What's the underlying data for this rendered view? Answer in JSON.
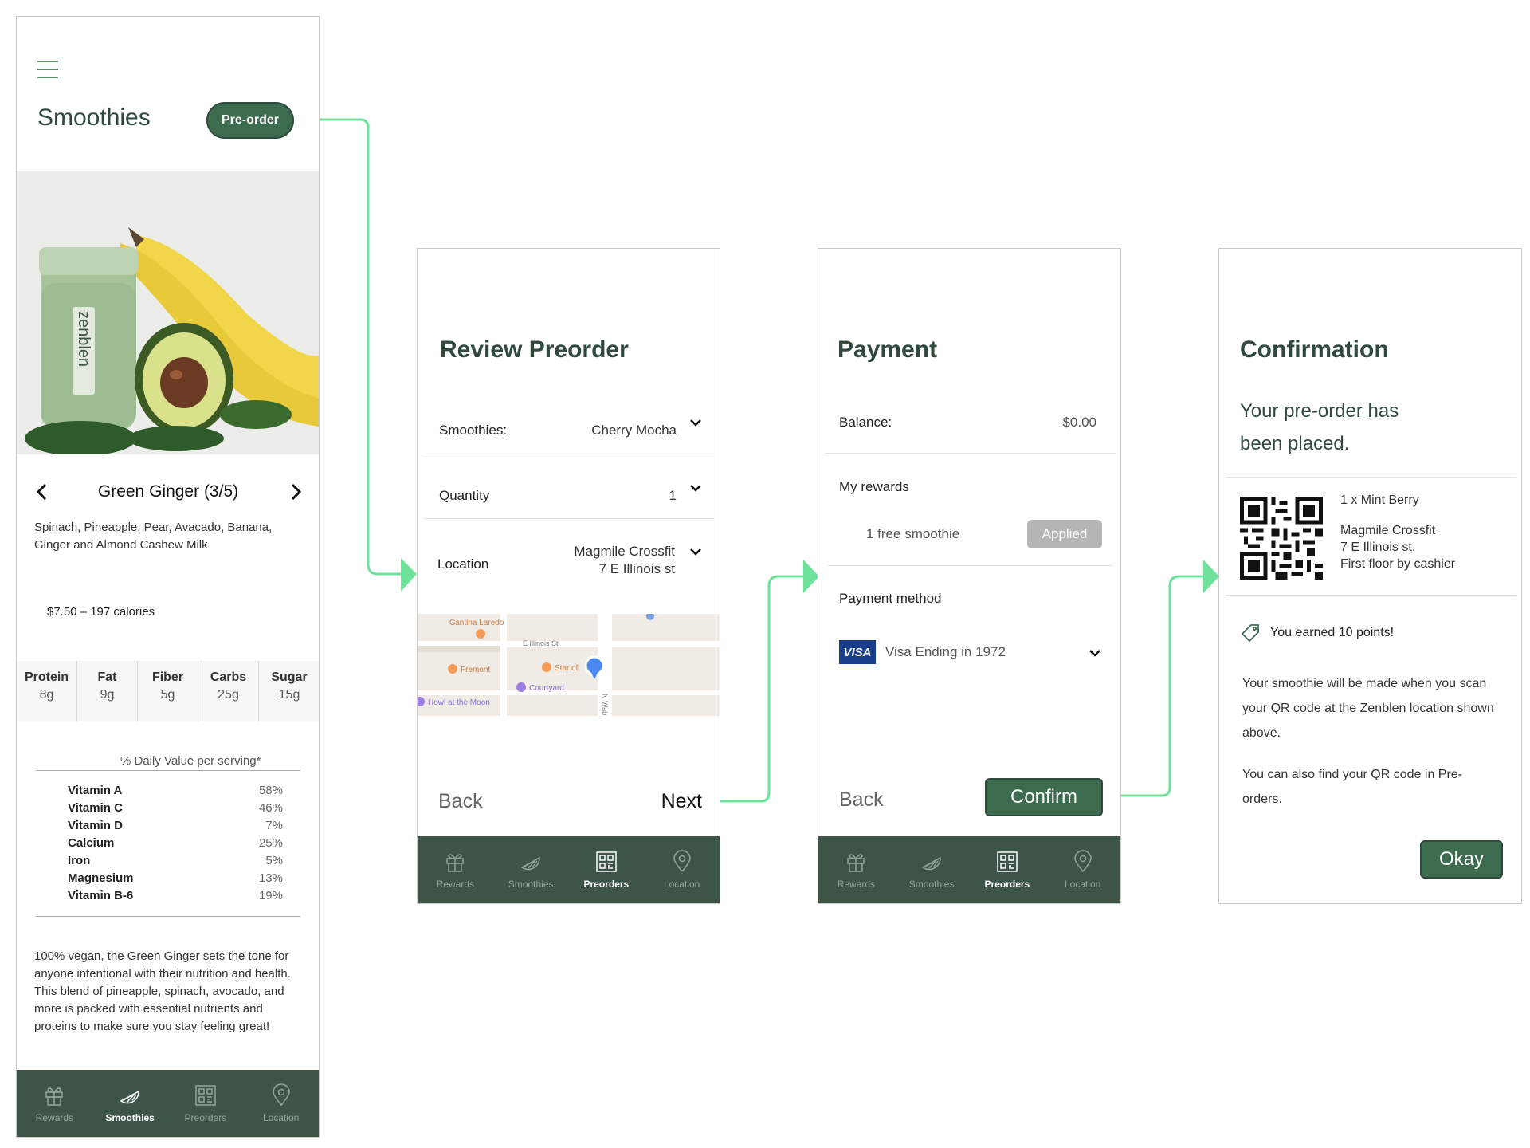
{
  "colors": {
    "brand_dark": "#2f4a3a",
    "brand_green": "#3d6b4f",
    "nav_bg": "#3d5546",
    "connector": "#6ee29a"
  },
  "nav": {
    "items": [
      {
        "key": "rewards",
        "label": "Rewards",
        "icon": "gift-icon"
      },
      {
        "key": "smoothies",
        "label": "Smoothies",
        "icon": "lime-icon"
      },
      {
        "key": "preorders",
        "label": "Preorders",
        "icon": "qr-code-icon"
      },
      {
        "key": "location",
        "label": "Location",
        "icon": "map-pin-icon"
      }
    ]
  },
  "screen1": {
    "title": "Smoothies",
    "preorder_button": "Pre-order",
    "product_name": "Green Ginger (3/5)",
    "ingredients": "Spinach, Pineapple, Pear, Avacado, Banana, Ginger and Almond Cashew Milk",
    "price_calories": "$7.50 – 197 calories",
    "image_brand_label": "zenblen",
    "nutrition": [
      {
        "name": "Protein",
        "value": "8g"
      },
      {
        "name": "Fat",
        "value": "9g"
      },
      {
        "name": "Fiber",
        "value": "5g"
      },
      {
        "name": "Carbs",
        "value": "25g"
      },
      {
        "name": "Sugar",
        "value": "15g"
      }
    ],
    "daily_value_header": "% Daily Value per serving*",
    "vitamins": [
      {
        "name": "Vitamin  A",
        "value": "58%"
      },
      {
        "name": "Vitamin C",
        "value": "46%"
      },
      {
        "name": "Vitamin D",
        "value": "7%"
      },
      {
        "name": "Calcium",
        "value": "25%"
      },
      {
        "name": "Iron",
        "value": "5%"
      },
      {
        "name": "Magnesium",
        "value": "13%"
      },
      {
        "name": "Vitamin B-6",
        "value": "19%"
      }
    ],
    "description": "100% vegan, the Green Ginger sets the tone for anyone intentional with their nutrition and health. This blend of pineapple, spinach, avocado, and more is packed with essential nutrients and proteins to make sure you stay feeling great!",
    "active_nav": "smoothies"
  },
  "screen2": {
    "title": "Review Preorder",
    "smoothies_label": "Smoothies:",
    "smoothies_value": "Cherry Mocha",
    "quantity_label": "Quantity",
    "quantity_value": "1",
    "location_label": "Location",
    "location_name": "Magmile Crossfit",
    "location_address": "7 E Illinois st",
    "map": {
      "places": [
        "Cantina Laredo",
        "Fremont",
        "Star of",
        "Courtyard",
        "Howl at the Moon"
      ],
      "streets": [
        "E Illinois St",
        "N Wab"
      ]
    },
    "back": "Back",
    "next": "Next",
    "active_nav": "preorders"
  },
  "screen3": {
    "title": "Payment",
    "balance_label": "Balance:",
    "balance_value": "$0.00",
    "rewards_label": "My rewards",
    "reward_item": "1 free smoothie",
    "applied_button": "Applied",
    "payment_method_label": "Payment method",
    "card_brand": "VISA",
    "card_text": "Visa Ending in 1972",
    "back": "Back",
    "confirm": "Confirm",
    "active_nav": "preorders"
  },
  "screen4": {
    "title": "Confirmation",
    "message_line1": "Your pre-order has",
    "message_line2": "been placed.",
    "order_item": "1 x Mint Berry",
    "location_name": "Magmile Crossfit",
    "location_address": "7 E Illinois st.",
    "location_detail": "First floor by cashier",
    "points": "You earned 10 points!",
    "info1": "Your smoothie will be made when you scan your QR code at the Zenblen location shown above.",
    "info2": "You can also find your QR code in Pre-orders.",
    "okay": "Okay"
  }
}
